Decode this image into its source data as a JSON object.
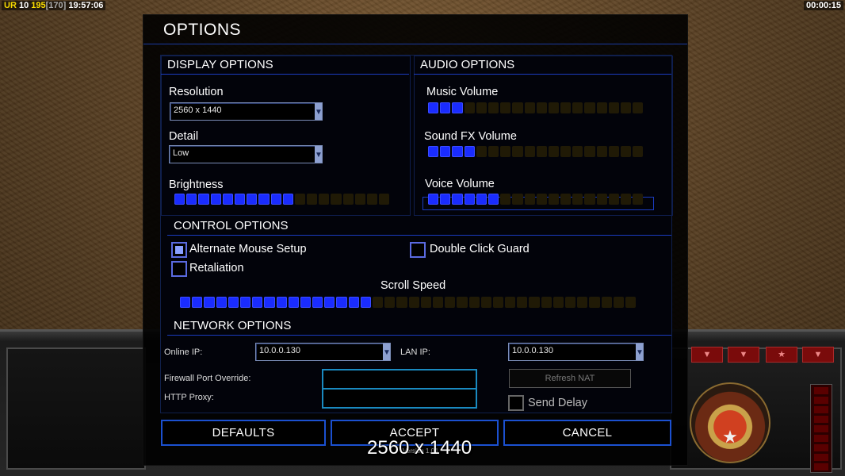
{
  "hud": {
    "rank": "UR",
    "level": "10",
    "money": "195",
    "power": "[170]",
    "clock": "19:57:06",
    "timer": "00:00:15"
  },
  "dialog": {
    "title": "OPTIONS",
    "display": {
      "header": "DISPLAY OPTIONS",
      "resolution_label": "Resolution",
      "resolution_value": "2560 x 1440",
      "detail_label": "Detail",
      "detail_value": "Low",
      "brightness_label": "Brightness",
      "brightness_level": 10,
      "brightness_segments": 18
    },
    "audio": {
      "header": "AUDIO OPTIONS",
      "music_label": "Music Volume",
      "music_level": 3,
      "sfx_label": "Sound FX Volume",
      "sfx_level": 4,
      "voice_label": "Voice Volume",
      "voice_level": 6,
      "segments": 18
    },
    "control": {
      "header": "CONTROL OPTIONS",
      "alt_mouse_label": "Alternate Mouse Setup",
      "alt_mouse_checked": true,
      "double_click_label": "Double Click Guard",
      "double_click_checked": false,
      "retaliation_label": "Retaliation",
      "retaliation_checked": false,
      "scroll_label": "Scroll Speed",
      "scroll_level": 16,
      "scroll_segments": 38
    },
    "network": {
      "header": "NETWORK OPTIONS",
      "online_ip_label": "Online IP:",
      "online_ip_value": "10.0.0.130",
      "lan_ip_label": "LAN IP:",
      "lan_ip_value": "10.0.0.130",
      "firewall_label": "Firewall Port Override:",
      "firewall_value": "",
      "proxy_label": "HTTP Proxy:",
      "proxy_value": "",
      "refresh_nat_label": "Refresh NAT",
      "send_delay_label": "Send Delay",
      "send_delay_checked": false
    },
    "buttons": {
      "defaults": "DEFAULTS",
      "accept": "ACCEPT",
      "cancel": "CANCEL"
    },
    "version": "Version 1.04"
  },
  "caption": "2560 x 1440",
  "colors": {
    "accent": "#1b3cc0",
    "slider_on": "#1a2cff",
    "slider_off": "#201a06"
  },
  "icons": {
    "dropdown": "chevron-down-icon",
    "checkbox": "checkbox-icon",
    "emblem": "faction-emblem-icon"
  }
}
